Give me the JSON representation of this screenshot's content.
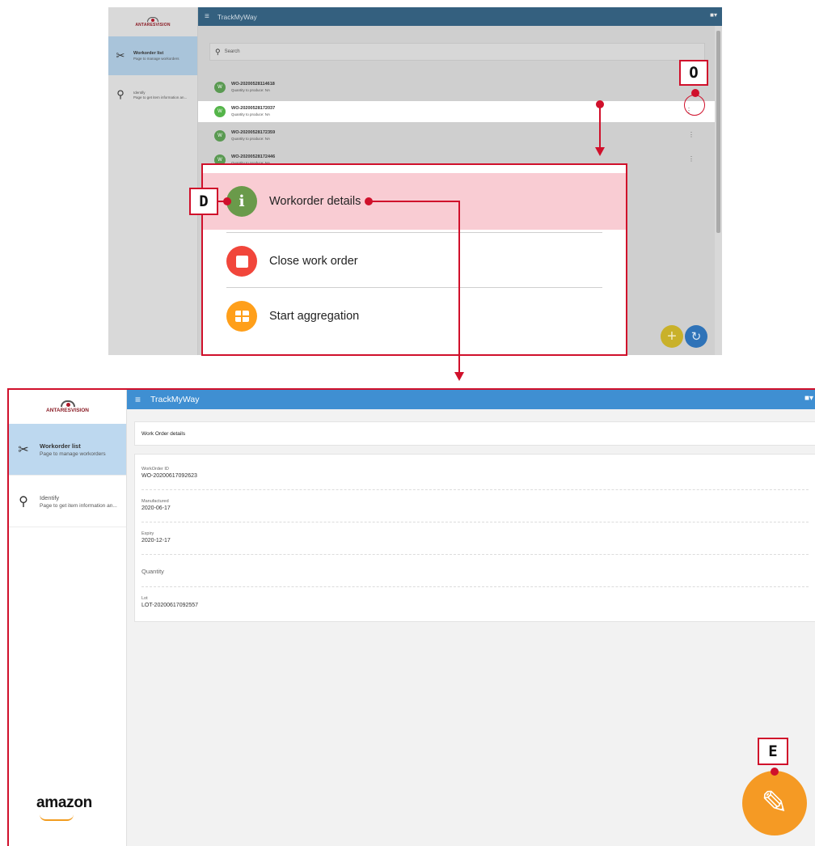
{
  "top": {
    "brand": "ANTARESVISION",
    "app_title": "TrackMyWay",
    "sidebar": [
      {
        "title": "Workorder list",
        "subtitle": "Page to manage workorders"
      },
      {
        "title": "Identify",
        "subtitle": "Page to get item information an..."
      }
    ],
    "search_placeholder": "Search",
    "rows": [
      {
        "avatar": "W",
        "id": "WO-20200528114618",
        "subtitle": "Quantity to produce: NA"
      },
      {
        "avatar": "W",
        "id": "WO-20200528172037",
        "subtitle": "Quantity to produce: NA"
      },
      {
        "avatar": "W",
        "id": "WO-20200528172359",
        "subtitle": "Quantity to produce: NA"
      },
      {
        "avatar": "W",
        "id": "WO-20200528172446",
        "subtitle": "Quantity to produce: NA"
      }
    ],
    "row_menu_glyph": "⋮"
  },
  "popup": {
    "items": [
      {
        "label": "Workorder details",
        "icon": "info-icon",
        "color": "#6a9a4a"
      },
      {
        "label": "Close work order",
        "icon": "stop-icon",
        "color": "#f1463b"
      },
      {
        "label": "Start aggregation",
        "icon": "box-icon",
        "color": "#ff9f1a"
      }
    ]
  },
  "callouts": {
    "o": "O",
    "d": "D",
    "e": "E"
  },
  "bottom": {
    "brand": "ANTARESVISION",
    "app_title": "TrackMyWay",
    "sidebar": [
      {
        "title": "Workorder list",
        "subtitle": "Page to manage workorders"
      },
      {
        "title": "Identify",
        "subtitle": "Page to get item information an..."
      }
    ],
    "card_title": "Work Order details",
    "fields": [
      {
        "label": "WorkOrder ID",
        "value": "WO-20200617092623"
      },
      {
        "label": "Manufactured",
        "value": "2020-06-17"
      },
      {
        "label": "Expiry",
        "value": "2020-12-17"
      },
      {
        "label": "Quantity",
        "value": ""
      },
      {
        "label": "Lot",
        "value": "LOT-20200617092557"
      }
    ],
    "footer_logo": "amazon"
  },
  "colors": {
    "accent_red": "#d0102b",
    "header_blue": "#3f8fd2",
    "edit_orange": "#f59a24"
  }
}
